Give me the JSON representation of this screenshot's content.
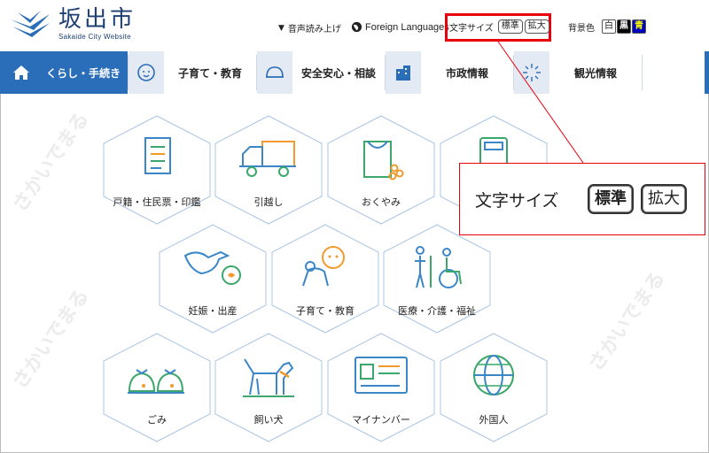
{
  "header": {
    "logo_title": "坂出市",
    "logo_subtitle": "Sakaide City Website",
    "voice_label": "音声読み上げ",
    "language_label": "Foreign Languages",
    "text_size": {
      "label": "文字サイズ",
      "standard": "標準",
      "large": "拡大"
    },
    "bg_color": {
      "label": "背景色",
      "white": "白",
      "black": "黒",
      "blue": "青"
    }
  },
  "nav": {
    "items": [
      {
        "label": "くらし・手続き",
        "icon": "home-icon"
      },
      {
        "label": "子育て・教育",
        "icon": "baby-icon"
      },
      {
        "label": "安全安心・相談",
        "icon": "helmet-icon"
      },
      {
        "label": "市政情報",
        "icon": "building-icon"
      },
      {
        "label": "観光情報",
        "icon": "firework-icon"
      }
    ]
  },
  "tiles": [
    {
      "label": "戸籍・住民票・印鑑",
      "icon": "document-icon"
    },
    {
      "label": "引越し",
      "icon": "truck-icon"
    },
    {
      "label": "おくやみ",
      "icon": "incense-icon"
    },
    {
      "label": "",
      "icon": "calculator-icon"
    },
    {
      "label": "妊娠・出産",
      "icon": "stork-icon"
    },
    {
      "label": "子育て・教育",
      "icon": "child-icon"
    },
    {
      "label": "医療・介護・福祉",
      "icon": "wheelchair-icon"
    },
    {
      "label": "ごみ",
      "icon": "garbage-bag-icon"
    },
    {
      "label": "飼い犬",
      "icon": "dog-icon"
    },
    {
      "label": "マイナンバー",
      "icon": "id-card-icon"
    },
    {
      "label": "外国人",
      "icon": "globe-icon"
    }
  ],
  "callout": {
    "label": "文字サイズ",
    "standard": "標準",
    "large": "拡大"
  },
  "watermark": "さかいでまる",
  "colors": {
    "brand_blue": "#2a6db8",
    "highlight_red": "#e8000b",
    "icon_green": "#3aa86a",
    "icon_orange": "#f39a2e",
    "icon_blue": "#3b86c6"
  }
}
